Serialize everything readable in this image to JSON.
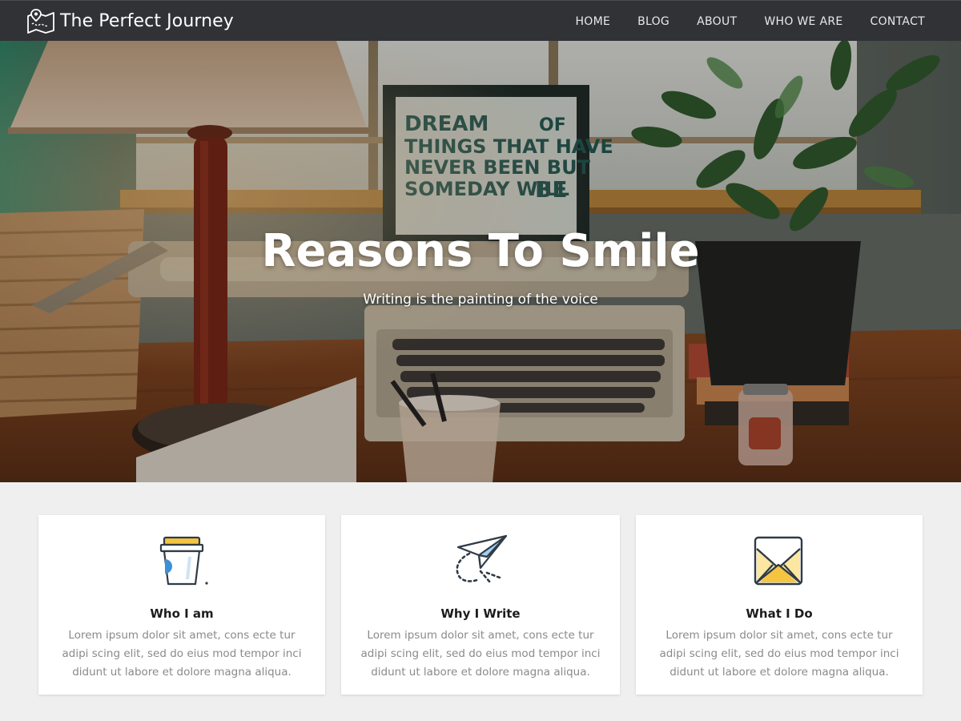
{
  "header": {
    "brand_name": "The Perfect Journey",
    "brand_icon": "map-pin-icon",
    "nav": [
      {
        "label": "HOME"
      },
      {
        "label": "BLOG"
      },
      {
        "label": "ABOUT"
      },
      {
        "label": "WHO WE ARE"
      },
      {
        "label": "CONTACT"
      }
    ]
  },
  "hero": {
    "title": "Reasons To Smile",
    "subtitle": "Writing is the painting of the voice",
    "poster_lines": [
      "DREAM OF",
      "THINGS THAT HAVE",
      "NEVER BEEN BUT",
      "SOMEDAY WILL BE"
    ]
  },
  "features": [
    {
      "icon": "coffee-cup-icon",
      "title": "Who I am",
      "body": "Lorem ipsum dolor sit amet, cons ecte tur adipi scing elit, sed do eius mod tempor inci didunt ut labore et dolore magna aliqua."
    },
    {
      "icon": "paper-plane-icon",
      "title": "Why I Write",
      "body": "Lorem ipsum dolor sit amet, cons ecte tur adipi scing elit, sed do eius mod tempor inci didunt ut labore et dolore magna aliqua."
    },
    {
      "icon": "envelope-icon",
      "title": "What I Do",
      "body": "Lorem ipsum dolor sit amet, cons ecte tur adipi scing elit, sed do eius mod tempor inci didunt ut labore et dolore magna aliqua."
    }
  ],
  "colors": {
    "header_bg": "#303236",
    "page_bg": "#efefef",
    "icon_accent_yellow": "#f5c542",
    "icon_accent_blue": "#3d8fd6"
  }
}
